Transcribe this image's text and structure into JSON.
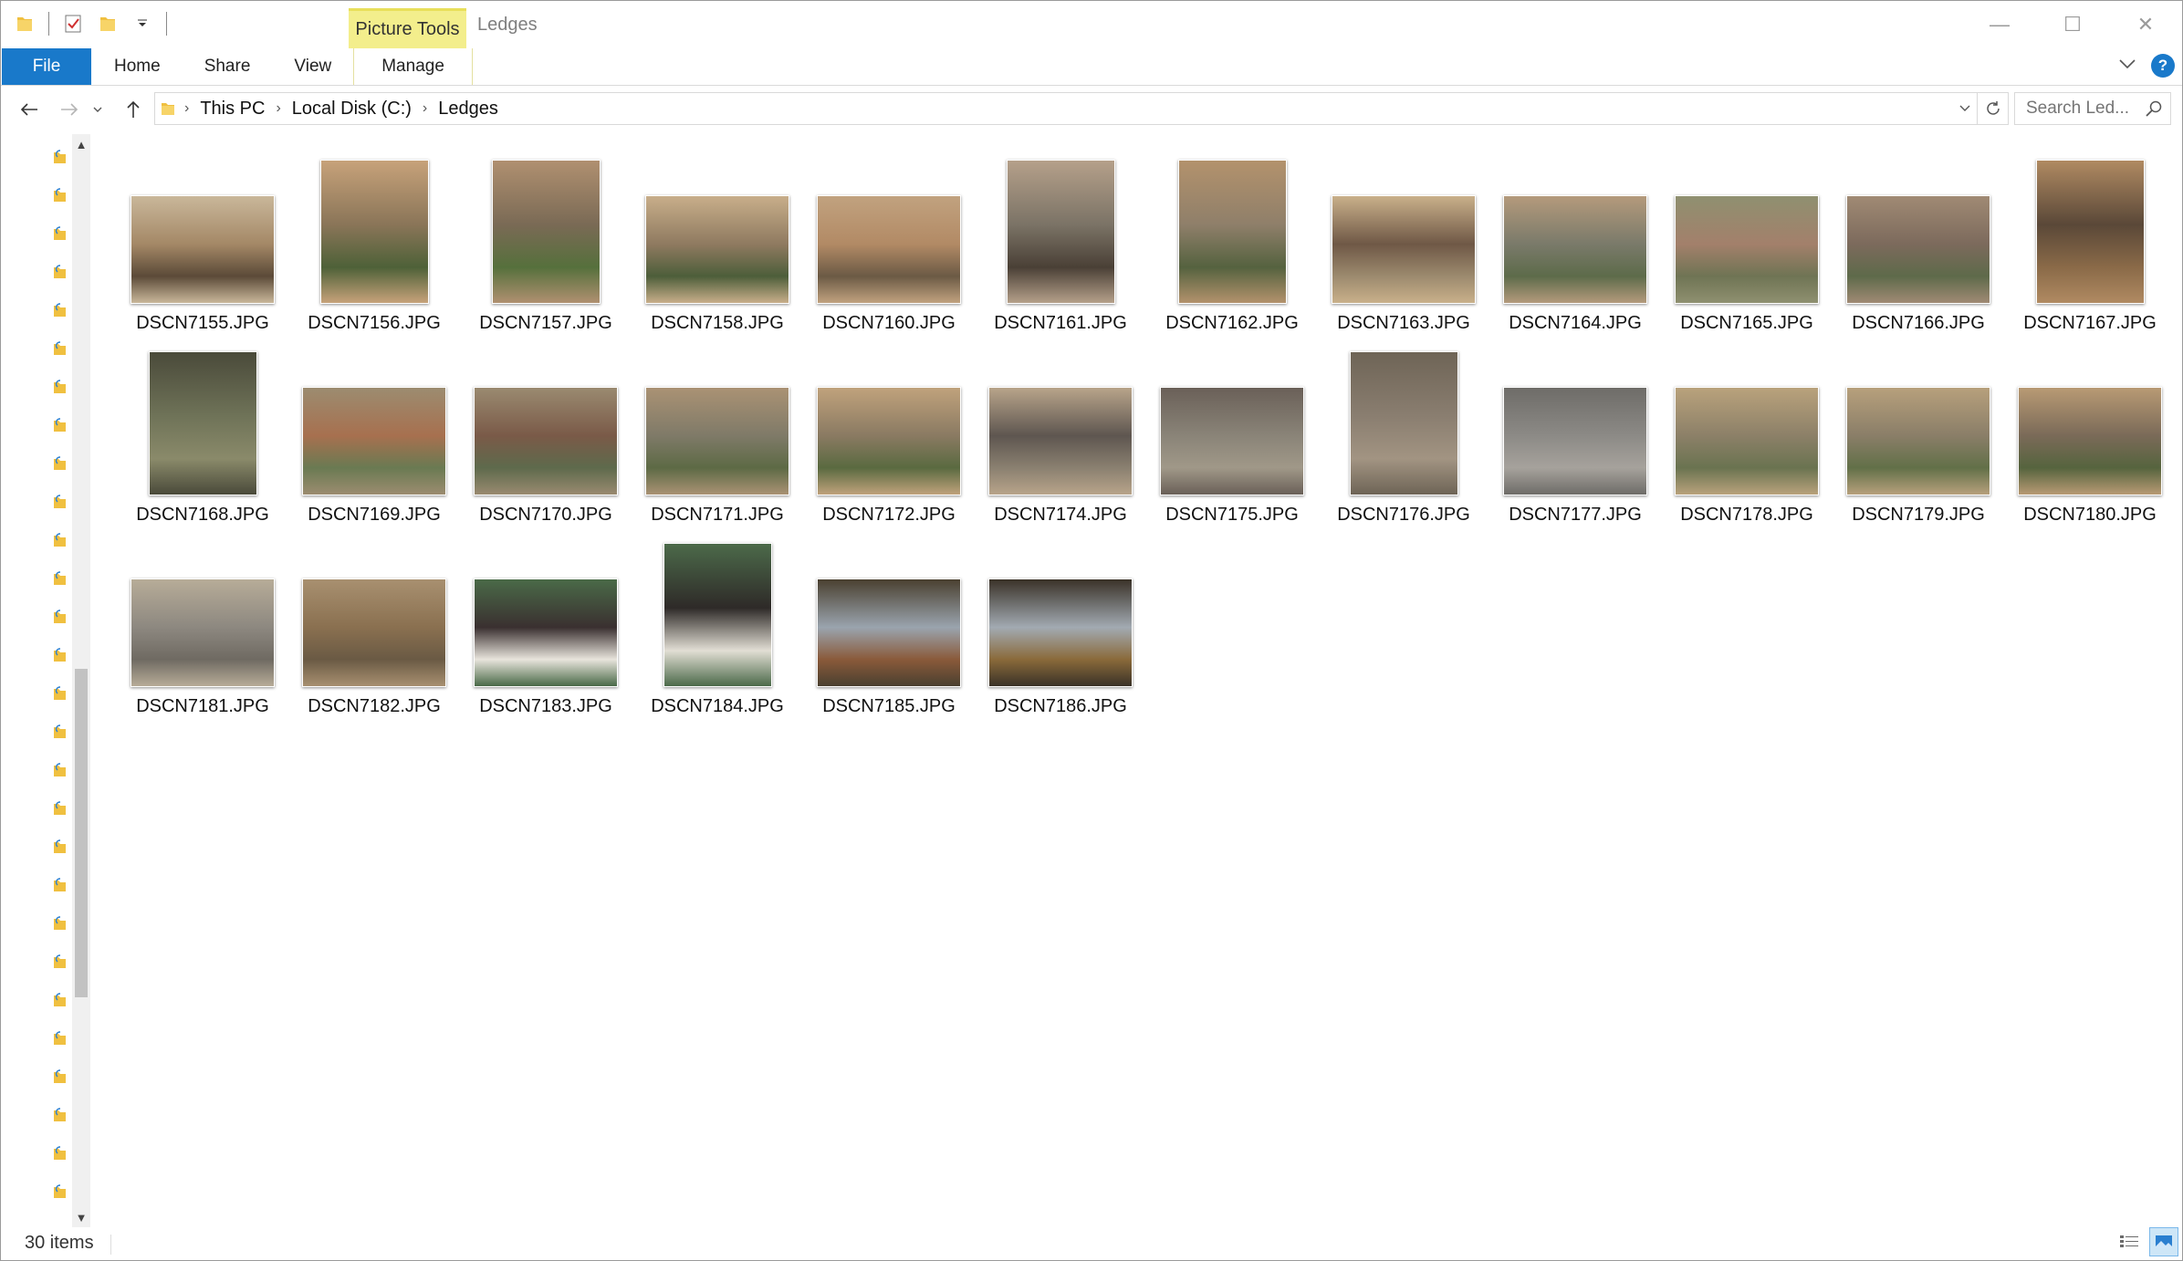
{
  "window": {
    "title": "Ledges",
    "context_tab": "Picture Tools",
    "caption_buttons": {
      "minimize": "—",
      "maximize": "☐",
      "close": "✕"
    }
  },
  "ribbon": {
    "file_tab": "File",
    "tabs": [
      "Home",
      "Share",
      "View",
      "Manage"
    ]
  },
  "address": {
    "crumbs": [
      "This PC",
      "Local Disk (C:)",
      "Ledges"
    ],
    "search_placeholder": "Search Led..."
  },
  "files": [
    {
      "name": "DSCN7155.JPG",
      "orientation": "landscape",
      "colors": [
        "#a48866",
        "#5b4a38",
        "#c9b79a"
      ]
    },
    {
      "name": "DSCN7156.JPG",
      "orientation": "portrait",
      "colors": [
        "#8a7558",
        "#4e6138",
        "#c7a27a"
      ]
    },
    {
      "name": "DSCN7157.JPG",
      "orientation": "portrait",
      "colors": [
        "#7a6a55",
        "#56703c",
        "#b09070"
      ]
    },
    {
      "name": "DSCN7158.JPG",
      "orientation": "landscape",
      "colors": [
        "#8f7a60",
        "#4d5e3a",
        "#c8ae8a"
      ]
    },
    {
      "name": "DSCN7160.JPG",
      "orientation": "landscape",
      "colors": [
        "#b28a65",
        "#6b5a45",
        "#c1a27f"
      ]
    },
    {
      "name": "DSCN7161.JPG",
      "orientation": "portrait",
      "colors": [
        "#7b7366",
        "#4a4036",
        "#b5a08a"
      ]
    },
    {
      "name": "DSCN7162.JPG",
      "orientation": "portrait",
      "colors": [
        "#8f7f6a",
        "#55623f",
        "#b3926c"
      ]
    },
    {
      "name": "DSCN7163.JPG",
      "orientation": "landscape",
      "colors": [
        "#6f5846",
        "#9c8a6e",
        "#c9b08a"
      ]
    },
    {
      "name": "DSCN7164.JPG",
      "orientation": "landscape",
      "colors": [
        "#7a7a6a",
        "#5d6b4a",
        "#b49a7c"
      ]
    },
    {
      "name": "DSCN7165.JPG",
      "orientation": "landscape",
      "colors": [
        "#a3806b",
        "#6f7454",
        "#8f9070"
      ]
    },
    {
      "name": "DSCN7166.JPG",
      "orientation": "landscape",
      "colors": [
        "#7c6a5c",
        "#5e6a4a",
        "#a08a74"
      ]
    },
    {
      "name": "DSCN7167.JPG",
      "orientation": "portrait",
      "colors": [
        "#5a4838",
        "#8a6a48",
        "#b08a62"
      ]
    },
    {
      "name": "DSCN7168.JPG",
      "orientation": "portrait",
      "colors": [
        "#6f7358",
        "#8a8a6a",
        "#4a4a3a"
      ]
    },
    {
      "name": "DSCN7169.JPG",
      "orientation": "landscape",
      "colors": [
        "#a7704f",
        "#6a7a52",
        "#9c8c70"
      ]
    },
    {
      "name": "DSCN7170.JPG",
      "orientation": "landscape",
      "colors": [
        "#7a5a48",
        "#5e6a4c",
        "#9a8a70"
      ]
    },
    {
      "name": "DSCN7171.JPG",
      "orientation": "landscape",
      "colors": [
        "#7f7a68",
        "#5d6a45",
        "#aa9274"
      ]
    },
    {
      "name": "DSCN7172.JPG",
      "orientation": "landscape",
      "colors": [
        "#8a7a62",
        "#5a6a40",
        "#c0a27c"
      ]
    },
    {
      "name": "DSCN7174.JPG",
      "orientation": "landscape",
      "colors": [
        "#5e5650",
        "#8a8070",
        "#b8a48a"
      ]
    },
    {
      "name": "DSCN7175.JPG",
      "orientation": "landscape",
      "colors": [
        "#8a8478",
        "#a09888",
        "#6a6058"
      ]
    },
    {
      "name": "DSCN7176.JPG",
      "orientation": "portrait",
      "colors": [
        "#8a7e70",
        "#a29482",
        "#6e6456"
      ]
    },
    {
      "name": "DSCN7177.JPG",
      "orientation": "landscape",
      "colors": [
        "#8c8a86",
        "#a6a29c",
        "#6e6c68"
      ]
    },
    {
      "name": "DSCN7178.JPG",
      "orientation": "landscape",
      "colors": [
        "#8c8068",
        "#6a7350",
        "#b9a27c"
      ]
    },
    {
      "name": "DSCN7179.JPG",
      "orientation": "landscape",
      "colors": [
        "#8a7e68",
        "#627048",
        "#b7a07c"
      ]
    },
    {
      "name": "DSCN7180.JPG",
      "orientation": "landscape",
      "colors": [
        "#7a6a58",
        "#56643e",
        "#b89a74"
      ]
    },
    {
      "name": "DSCN7181.JPG",
      "orientation": "landscape",
      "colors": [
        "#8d8880",
        "#6f6a62",
        "#b7ac98"
      ]
    },
    {
      "name": "DSCN7182.JPG",
      "orientation": "landscape",
      "colors": [
        "#8a7050",
        "#6a5a44",
        "#a89070"
      ]
    },
    {
      "name": "DSCN7183.JPG",
      "orientation": "landscape",
      "colors": [
        "#3a3030",
        "#e8e4dc",
        "#4a6a48"
      ]
    },
    {
      "name": "DSCN7184.JPG",
      "orientation": "portrait",
      "colors": [
        "#2e2a28",
        "#e2ded4",
        "#4c6a4a"
      ]
    },
    {
      "name": "DSCN7185.JPG",
      "orientation": "landscape",
      "colors": [
        "#9aa4ae",
        "#8a5a3a",
        "#4a4030"
      ]
    },
    {
      "name": "DSCN7186.JPG",
      "orientation": "landscape",
      "colors": [
        "#a2aab2",
        "#8a6a3a",
        "#3a3228"
      ]
    }
  ],
  "status": {
    "item_count": "30 items"
  },
  "accent_color": "#1979ca"
}
